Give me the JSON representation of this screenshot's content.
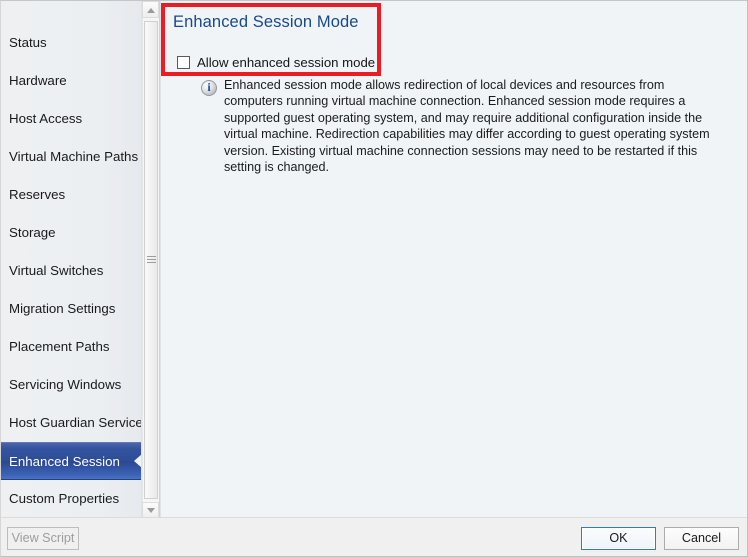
{
  "window": {
    "accent_blue": "#2e4d96",
    "title_color": "#174a8b",
    "highlight_color": "#ec1c24",
    "content_background": "#f1f4f7"
  },
  "sidebar": {
    "items": [
      {
        "label": "Status",
        "selected": false
      },
      {
        "label": "Hardware",
        "selected": false
      },
      {
        "label": "Host Access",
        "selected": false
      },
      {
        "label": "Virtual Machine Paths",
        "selected": false
      },
      {
        "label": "Reserves",
        "selected": false
      },
      {
        "label": "Storage",
        "selected": false
      },
      {
        "label": "Virtual Switches",
        "selected": false
      },
      {
        "label": "Migration Settings",
        "selected": false
      },
      {
        "label": "Placement Paths",
        "selected": false
      },
      {
        "label": "Servicing Windows",
        "selected": false
      },
      {
        "label": "Host Guardian Service",
        "selected": false
      },
      {
        "label": "Enhanced Session",
        "selected": true
      },
      {
        "label": "Custom Properties",
        "selected": false
      }
    ],
    "scrollbar": {
      "up_arrow": "scroll-up-arrow",
      "down_arrow": "scroll-down-arrow"
    }
  },
  "main": {
    "page_title": "Enhanced Session Mode",
    "checkbox": {
      "label": "Allow enhanced session mode",
      "checked": false
    },
    "info": {
      "icon": "info-icon",
      "text": "Enhanced session mode allows redirection of local devices and resources from computers running virtual machine connection. Enhanced session mode requires a supported guest operating system, and may require additional configuration inside the virtual machine. Redirection capabilities may differ according to guest operating system version. Existing virtual machine connection sessions may need to be restarted if this setting is changed."
    }
  },
  "footer": {
    "view_script_label": "View Script",
    "ok_label": "OK",
    "cancel_label": "Cancel"
  }
}
